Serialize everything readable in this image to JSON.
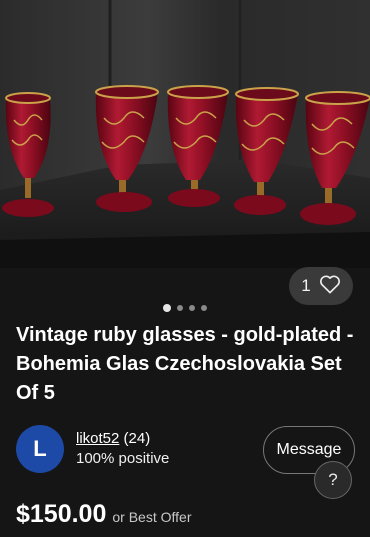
{
  "listing": {
    "photo": {
      "description_icon": "product-photo",
      "current_image": 1,
      "image_count": 4,
      "favorites": "1"
    },
    "title": "Vintage ruby glasses - gold-plated - Bohemia Glas Czechoslovakia Set Of 5",
    "seller": {
      "initial": "L",
      "name": "likot52",
      "feedback": "(24)",
      "positive": "100% positive"
    },
    "message_label": "Message",
    "help_label": "?",
    "price": "$150.00",
    "price_note": "or Best Offer"
  },
  "colors": {
    "background": "#151515",
    "avatar": "#1d4aa6",
    "ruby": "#8e0f24"
  }
}
